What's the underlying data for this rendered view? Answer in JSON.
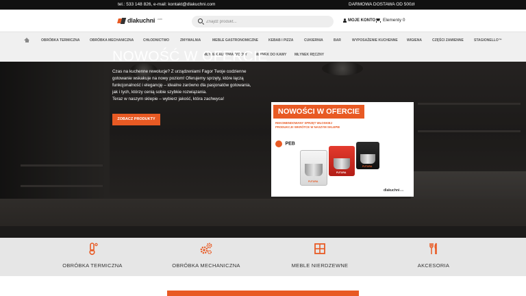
{
  "topbar": {
    "contact": "tel.: 533 148 826, e-mail: kontakt@dlakuchni.com",
    "shipping": "DARMOWA DOSTAWA OD 500zł"
  },
  "header": {
    "logo_text": "dlakuchni",
    "logo_tld": ".com",
    "search_placeholder": "Znajdź produkt...",
    "account_label": "MOJE KONTO",
    "cart_label": "Elementy 0"
  },
  "nav": {
    "row1": [
      "OBRÓBKA TERMICZNA",
      "OBRÓBKA MECHANICZNA",
      "CHŁODNICTWO",
      "ZMYWALNIA",
      "MEBLE GASTRONOMICZNE",
      "KEBAB I PIZZA",
      "CUKIERNIA",
      "BAR",
      "WYPOSAŻENIE KUCHENNE",
      "WIGIENA",
      "CZĘŚCI ZAMIENNE",
      "STAGIONELLO™"
    ],
    "row2": [
      "MŁYNEK AUTOMATYCZNY",
      "MŁYNEK DO KAWY",
      "MŁYNEK RĘCZNY"
    ]
  },
  "hero": {
    "title": "NOWOŚĆ W OFERCIE",
    "paragraph": "Czas na kuchenne rewolucje? Z urządzeniami Fagor Twoje codzienne gotowanie wskakuje na nowy poziom! Oferujemy sprzęty, które łączą funkcjonalność i elegancję – idealne zarówno dla pasjonatów gotowania, jak i tych, którzy cenią sobie szybkie rozwiązania.",
    "cta_line": "Teraz w naszym sklepie – wybierz jakość, która zachwyca!",
    "button": "ZOBACZ PRODUKTY"
  },
  "promo": {
    "title": "NOWOŚCI W OFERCIE",
    "line1": "REKOMENDOWANY SPRZĘT WŁOSKIEJ",
    "line2": "PRODUKCJI! WKRÓTCE W NASZYM SKLEPIE",
    "brand": "PEB",
    "mixer_tags": [
      "FUTURA",
      "FUTURA",
      "FUTURA"
    ],
    "footer_logo": "dlakuchni",
    "footer_tld": ".com"
  },
  "categories": [
    {
      "label": "OBRÓBKA TERMICZNA",
      "icon": "thermometer-icon"
    },
    {
      "label": "OBRÓBKA MECHANICZNA",
      "icon": "gears-icon"
    },
    {
      "label": "MEBLE NIERDZEWNE",
      "icon": "cabinet-icon"
    },
    {
      "label": "AKCESORIA",
      "icon": "cutlery-icon"
    }
  ],
  "colors": {
    "accent": "#e85a24",
    "topbar": "#111111",
    "nav_bg": "#f0f0f0",
    "categories_bg": "#e6e6e6"
  }
}
